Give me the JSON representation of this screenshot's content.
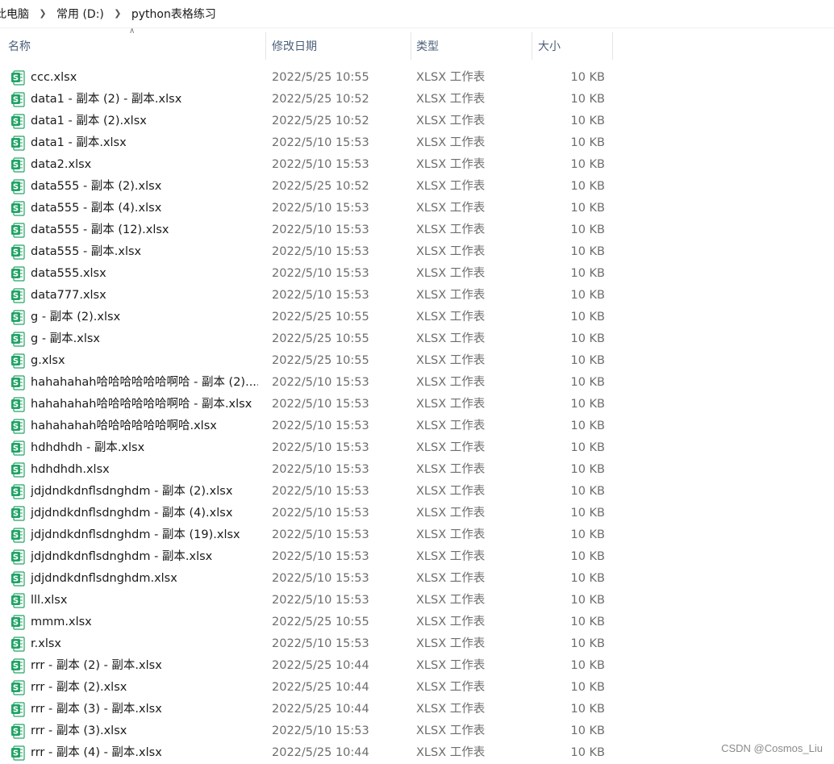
{
  "breadcrumb": [
    "此电脑",
    "常用 (D:)",
    "python表格练习"
  ],
  "columns": {
    "name": "名称",
    "modified": "修改日期",
    "type": "类型",
    "size": "大小"
  },
  "icon_color": "#21a366",
  "files": [
    {
      "name": "ccc.xlsx",
      "modified": "2022/5/25 10:55",
      "type": "XLSX 工作表",
      "size": "10 KB"
    },
    {
      "name": "data1 - 副本 (2) - 副本.xlsx",
      "modified": "2022/5/25 10:52",
      "type": "XLSX 工作表",
      "size": "10 KB"
    },
    {
      "name": "data1 - 副本 (2).xlsx",
      "modified": "2022/5/25 10:52",
      "type": "XLSX 工作表",
      "size": "10 KB"
    },
    {
      "name": "data1 - 副本.xlsx",
      "modified": "2022/5/10 15:53",
      "type": "XLSX 工作表",
      "size": "10 KB"
    },
    {
      "name": "data2.xlsx",
      "modified": "2022/5/10 15:53",
      "type": "XLSX 工作表",
      "size": "10 KB"
    },
    {
      "name": "data555 - 副本 (2).xlsx",
      "modified": "2022/5/25 10:52",
      "type": "XLSX 工作表",
      "size": "10 KB"
    },
    {
      "name": "data555 - 副本 (4).xlsx",
      "modified": "2022/5/10 15:53",
      "type": "XLSX 工作表",
      "size": "10 KB"
    },
    {
      "name": "data555 - 副本 (12).xlsx",
      "modified": "2022/5/10 15:53",
      "type": "XLSX 工作表",
      "size": "10 KB"
    },
    {
      "name": "data555 - 副本.xlsx",
      "modified": "2022/5/10 15:53",
      "type": "XLSX 工作表",
      "size": "10 KB"
    },
    {
      "name": "data555.xlsx",
      "modified": "2022/5/10 15:53",
      "type": "XLSX 工作表",
      "size": "10 KB"
    },
    {
      "name": "data777.xlsx",
      "modified": "2022/5/10 15:53",
      "type": "XLSX 工作表",
      "size": "10 KB"
    },
    {
      "name": "g - 副本 (2).xlsx",
      "modified": "2022/5/25 10:55",
      "type": "XLSX 工作表",
      "size": "10 KB"
    },
    {
      "name": "g - 副本.xlsx",
      "modified": "2022/5/25 10:55",
      "type": "XLSX 工作表",
      "size": "10 KB"
    },
    {
      "name": "g.xlsx",
      "modified": "2022/5/25 10:55",
      "type": "XLSX 工作表",
      "size": "10 KB"
    },
    {
      "name": "hahahahah哈哈哈哈哈哈啊哈 - 副本 (2)....",
      "modified": "2022/5/10 15:53",
      "type": "XLSX 工作表",
      "size": "10 KB"
    },
    {
      "name": "hahahahah哈哈哈哈哈哈啊哈 - 副本.xlsx",
      "modified": "2022/5/10 15:53",
      "type": "XLSX 工作表",
      "size": "10 KB"
    },
    {
      "name": "hahahahah哈哈哈哈哈哈啊哈.xlsx",
      "modified": "2022/5/10 15:53",
      "type": "XLSX 工作表",
      "size": "10 KB"
    },
    {
      "name": "hdhdhdh - 副本.xlsx",
      "modified": "2022/5/10 15:53",
      "type": "XLSX 工作表",
      "size": "10 KB"
    },
    {
      "name": "hdhdhdh.xlsx",
      "modified": "2022/5/10 15:53",
      "type": "XLSX 工作表",
      "size": "10 KB"
    },
    {
      "name": "jdjdndkdnflsdnghdm - 副本 (2).xlsx",
      "modified": "2022/5/10 15:53",
      "type": "XLSX 工作表",
      "size": "10 KB"
    },
    {
      "name": "jdjdndkdnflsdnghdm - 副本 (4).xlsx",
      "modified": "2022/5/10 15:53",
      "type": "XLSX 工作表",
      "size": "10 KB"
    },
    {
      "name": "jdjdndkdnflsdnghdm - 副本 (19).xlsx",
      "modified": "2022/5/10 15:53",
      "type": "XLSX 工作表",
      "size": "10 KB"
    },
    {
      "name": "jdjdndkdnflsdnghdm - 副本.xlsx",
      "modified": "2022/5/10 15:53",
      "type": "XLSX 工作表",
      "size": "10 KB"
    },
    {
      "name": "jdjdndkdnflsdnghdm.xlsx",
      "modified": "2022/5/10 15:53",
      "type": "XLSX 工作表",
      "size": "10 KB"
    },
    {
      "name": "lll.xlsx",
      "modified": "2022/5/10 15:53",
      "type": "XLSX 工作表",
      "size": "10 KB"
    },
    {
      "name": "mmm.xlsx",
      "modified": "2022/5/25 10:55",
      "type": "XLSX 工作表",
      "size": "10 KB"
    },
    {
      "name": "r.xlsx",
      "modified": "2022/5/10 15:53",
      "type": "XLSX 工作表",
      "size": "10 KB"
    },
    {
      "name": "rrr - 副本 (2) - 副本.xlsx",
      "modified": "2022/5/25 10:44",
      "type": "XLSX 工作表",
      "size": "10 KB"
    },
    {
      "name": "rrr - 副本 (2).xlsx",
      "modified": "2022/5/25 10:44",
      "type": "XLSX 工作表",
      "size": "10 KB"
    },
    {
      "name": "rrr - 副本 (3) - 副本.xlsx",
      "modified": "2022/5/25 10:44",
      "type": "XLSX 工作表",
      "size": "10 KB"
    },
    {
      "name": "rrr - 副本 (3).xlsx",
      "modified": "2022/5/10 15:53",
      "type": "XLSX 工作表",
      "size": "10 KB"
    },
    {
      "name": "rrr - 副本 (4) - 副本.xlsx",
      "modified": "2022/5/25 10:44",
      "type": "XLSX 工作表",
      "size": "10 KB"
    }
  ],
  "watermark": "CSDN @Cosmos_Liu"
}
